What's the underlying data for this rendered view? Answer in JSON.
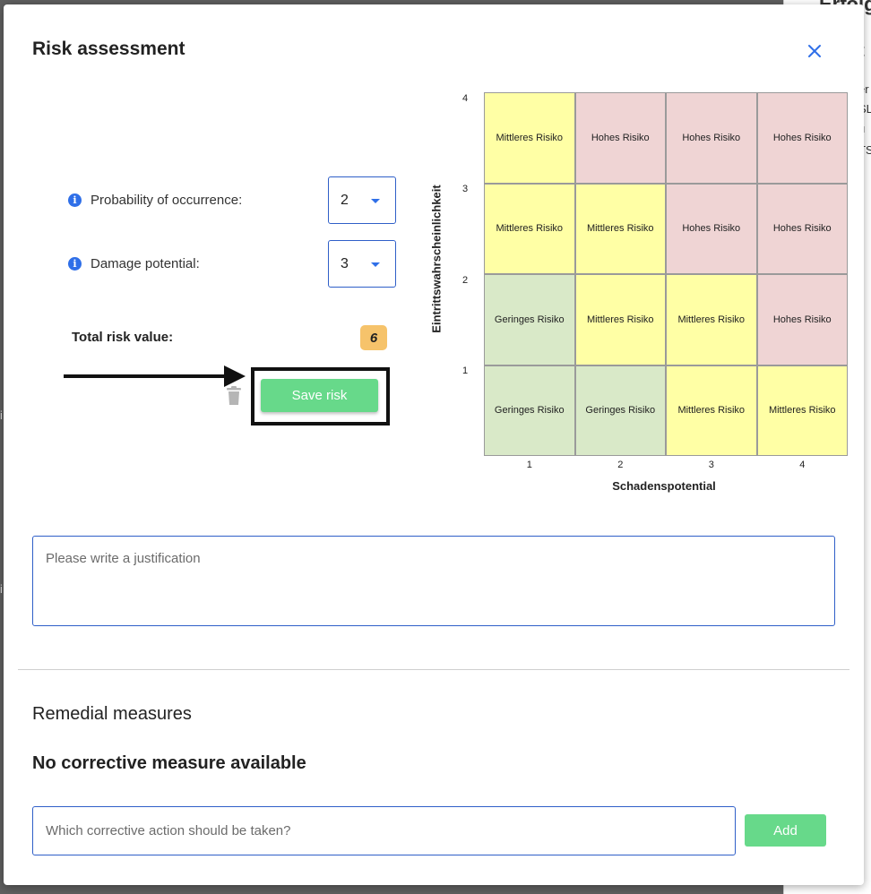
{
  "background": {
    "fragments": [
      "Erfolg",
      "t",
      "er",
      "SL",
      "u",
      "TS",
      "i",
      "i"
    ]
  },
  "modal": {
    "title": "Risk assessment",
    "close_icon": "close-icon"
  },
  "form": {
    "probability": {
      "label": "Probability of occurrence:",
      "value": "2",
      "info_icon": "info-icon"
    },
    "damage": {
      "label": "Damage potential:",
      "value": "3",
      "info_icon": "info-icon"
    },
    "total": {
      "label": "Total risk value:",
      "value": "6"
    },
    "save_label": "Save risk",
    "delete_icon": "trash-icon"
  },
  "chart_data": {
    "type": "heatmap",
    "xlabel": "Schadenspotential",
    "ylabel": "Eintrittswahrscheinlichkeit",
    "x": [
      "1",
      "2",
      "3",
      "4"
    ],
    "y": [
      "1",
      "2",
      "3",
      "4"
    ],
    "cells": [
      [
        "Geringes Risiko",
        "Geringes Risiko",
        "Mittleres Risiko",
        "Mittleres Risiko"
      ],
      [
        "Geringes Risiko",
        "Mittleres Risiko",
        "Mittleres Risiko",
        "Hohes Risiko"
      ],
      [
        "Mittleres Risiko",
        "Mittleres Risiko",
        "Hohes Risiko",
        "Hohes Risiko"
      ],
      [
        "Mittleres Risiko",
        "Hohes Risiko",
        "Hohes Risiko",
        "Hohes Risiko"
      ]
    ],
    "colors": {
      "Geringes Risiko": "#d9e9c8",
      "Mittleres Risiko": "#ffffa5",
      "Hohes Risiko": "#efd4d4"
    }
  },
  "justification": {
    "placeholder": "Please write a justification"
  },
  "remedial": {
    "title": "Remedial measures",
    "empty_message": "No corrective measure available",
    "input_placeholder": "Which corrective action should be taken?",
    "add_label": "Add"
  }
}
